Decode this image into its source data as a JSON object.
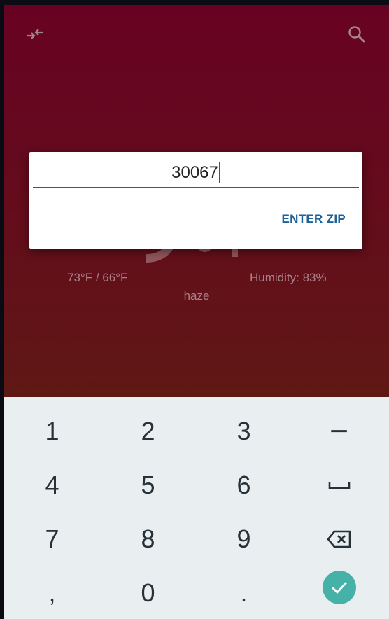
{
  "toolbar": {
    "swap_icon": "swap-arrows-icon",
    "search_icon": "search-icon"
  },
  "weather": {
    "temp_range": "73°F / 66°F",
    "humidity": "Humidity: 83%",
    "conditions": "haze"
  },
  "dialog": {
    "zip_value": "30067",
    "enter_label": "ENTER ZIP"
  },
  "keyboard": {
    "rows": [
      [
        "1",
        "2",
        "3",
        "−"
      ],
      [
        "4",
        "5",
        "6",
        "space"
      ],
      [
        "7",
        "8",
        "9",
        "backspace"
      ],
      [
        ",",
        "0",
        ".",
        "done"
      ]
    ]
  },
  "colors": {
    "accent": "#1d6199",
    "done": "#46b1a6",
    "bg_top": "#680223",
    "bg_bottom": "#5f1814"
  }
}
